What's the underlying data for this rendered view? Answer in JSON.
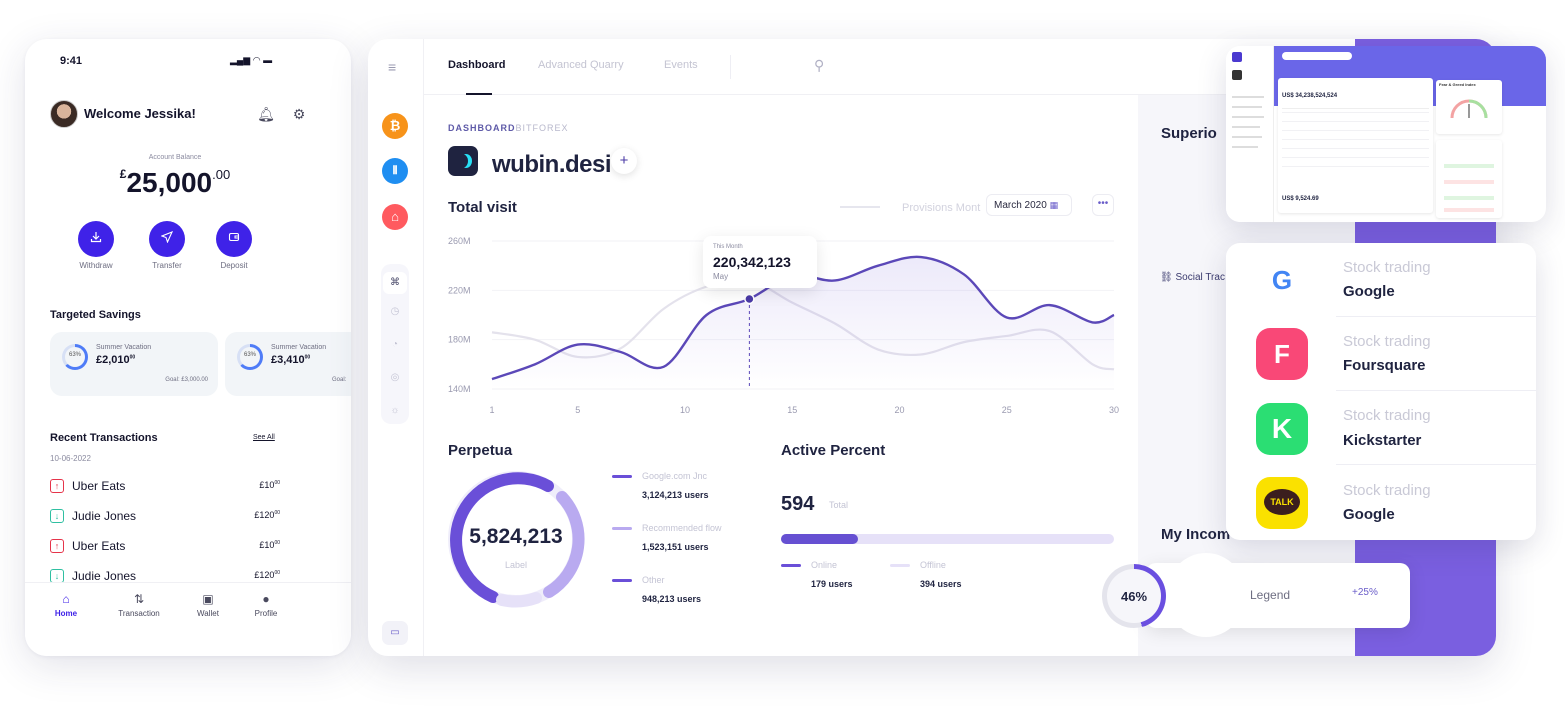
{
  "phone": {
    "status_time": "9:41",
    "status_icons": "▂▄▆ ◠ ▬",
    "welcome": "Welcome Jessika!",
    "balance_label": "Account Balance",
    "balance_currency": "£",
    "balance_main": "25,000",
    "balance_decimal": ".00",
    "actions": [
      {
        "label": "Withdraw",
        "icon": "download-icon"
      },
      {
        "label": "Transfer",
        "icon": "send-icon"
      },
      {
        "label": "Deposit",
        "icon": "wallet-icon"
      }
    ],
    "savings_title": "Targeted Savings",
    "savings": [
      {
        "percent": "63%",
        "title": "Summer Vacation",
        "amount": "£2,010",
        "amount_dec": "00",
        "goal": "Goal: £3,000.00",
        "progress": 0.63
      },
      {
        "percent": "63%",
        "title": "Summer Vacation",
        "amount": "£3,410",
        "amount_dec": "00",
        "goal": "Goal:",
        "progress": 0.63
      }
    ],
    "transactions_title": "Recent Transactions",
    "see_all": "See All",
    "tx_date": "10-06-2022",
    "transactions": [
      {
        "name": "Uber Eats",
        "amount": "£10",
        "dec": "00",
        "type": "out"
      },
      {
        "name": "Judie Jones",
        "amount": "£120",
        "dec": "00",
        "type": "in"
      },
      {
        "name": "Uber Eats",
        "amount": "£10",
        "dec": "00",
        "type": "out"
      },
      {
        "name": "Judie Jones",
        "amount": "£120",
        "dec": "00",
        "type": "in"
      }
    ],
    "nav": [
      {
        "label": "Home",
        "icon": "home-icon",
        "active": true
      },
      {
        "label": "Transaction",
        "icon": "transfer-icon",
        "active": false
      },
      {
        "label": "Wallet",
        "icon": "wallet-icon",
        "active": false
      },
      {
        "label": "Profile",
        "icon": "user-icon",
        "active": false
      }
    ]
  },
  "dashboard": {
    "tabs": [
      "Dashboard",
      "Advanced Quarry",
      "Events"
    ],
    "breadcrumb_main": "DASHBOARD",
    "breadcrumb_sub": "BITFOREX",
    "brand": "wubin.desi",
    "total_visit_title": "Total visit",
    "provisions": "Provisions Mont",
    "date_select": "March 2020",
    "more": "•••",
    "tooltip": {
      "label": "This Month",
      "value": "220,342,123",
      "sub": "May"
    },
    "perpetua_title": "Perpetua",
    "donut_value": "5,824,213",
    "donut_label": "Label",
    "legend": [
      {
        "name": "Google.com Jnc",
        "value": "3,124,213 users",
        "color": "#6a4fd8"
      },
      {
        "name": "Recommended flow",
        "value": "1,523,151 users",
        "color": "#b9aaf0"
      },
      {
        "name": "Other",
        "value": "948,213 users",
        "color": "#6a4fd8"
      }
    ],
    "active_title": "Active Percent",
    "active_value": "594",
    "active_total": "Total",
    "active_fill": 0.23,
    "online_label": "Online",
    "online_value": "179 users",
    "offline_label": "Offline",
    "offline_value": "394 users",
    "right_title_1": "Superio",
    "right_link": "Social Trac",
    "right_title_2": "My Incom"
  },
  "chart_data": {
    "type": "line",
    "x": [
      1,
      3,
      5,
      7,
      9,
      11,
      13,
      15,
      17,
      19,
      21,
      23,
      25,
      27,
      29,
      30
    ],
    "x_ticks": [
      "1",
      "5",
      "10",
      "15",
      "20",
      "25",
      "30"
    ],
    "y_ticks": [
      "260M",
      "220M",
      "180M",
      "140M"
    ],
    "ylim": [
      140,
      260
    ],
    "series": [
      {
        "values": [
          148,
          160,
          176,
          170,
          158,
          200,
          213,
          232,
          228,
          240,
          247,
          233,
          198,
          208,
          194,
          200
        ],
        "color": "#5b48b8",
        "fill": true
      },
      {
        "values": [
          186,
          180,
          166,
          173,
          205,
          223,
          228,
          210,
          193,
          172,
          168,
          178,
          183,
          187,
          160,
          156
        ],
        "color": "#e4e2ec",
        "fill": false
      }
    ],
    "highlight_x": 13
  },
  "mini": {
    "title": "Fear & Greed Index",
    "balance": "US$ 34,238,524,524",
    "balance2": "US$ 9,524.69"
  },
  "stocks": [
    {
      "category": "Stock trading",
      "name": "Google",
      "icon": "google-icon",
      "bg": "#ffffff",
      "glyph": "G"
    },
    {
      "category": "Stock trading",
      "name": "Foursquare",
      "icon": "foursquare-icon",
      "bg": "#f94877",
      "glyph": "F"
    },
    {
      "category": "Stock trading",
      "name": "Kickstarter",
      "icon": "kickstarter-icon",
      "bg": "#2bde73",
      "glyph": "K"
    },
    {
      "category": "Stock trading",
      "name": "Google",
      "icon": "kakaotalk-icon",
      "bg": "#fae100",
      "glyph": "TALK"
    }
  ],
  "income_widget": {
    "percent": "46%",
    "legend": "Legend",
    "change": "+25%"
  },
  "colors": {
    "accent": "#3f22e8",
    "purple": "#7a5fe0",
    "line": "#5b48b8"
  }
}
